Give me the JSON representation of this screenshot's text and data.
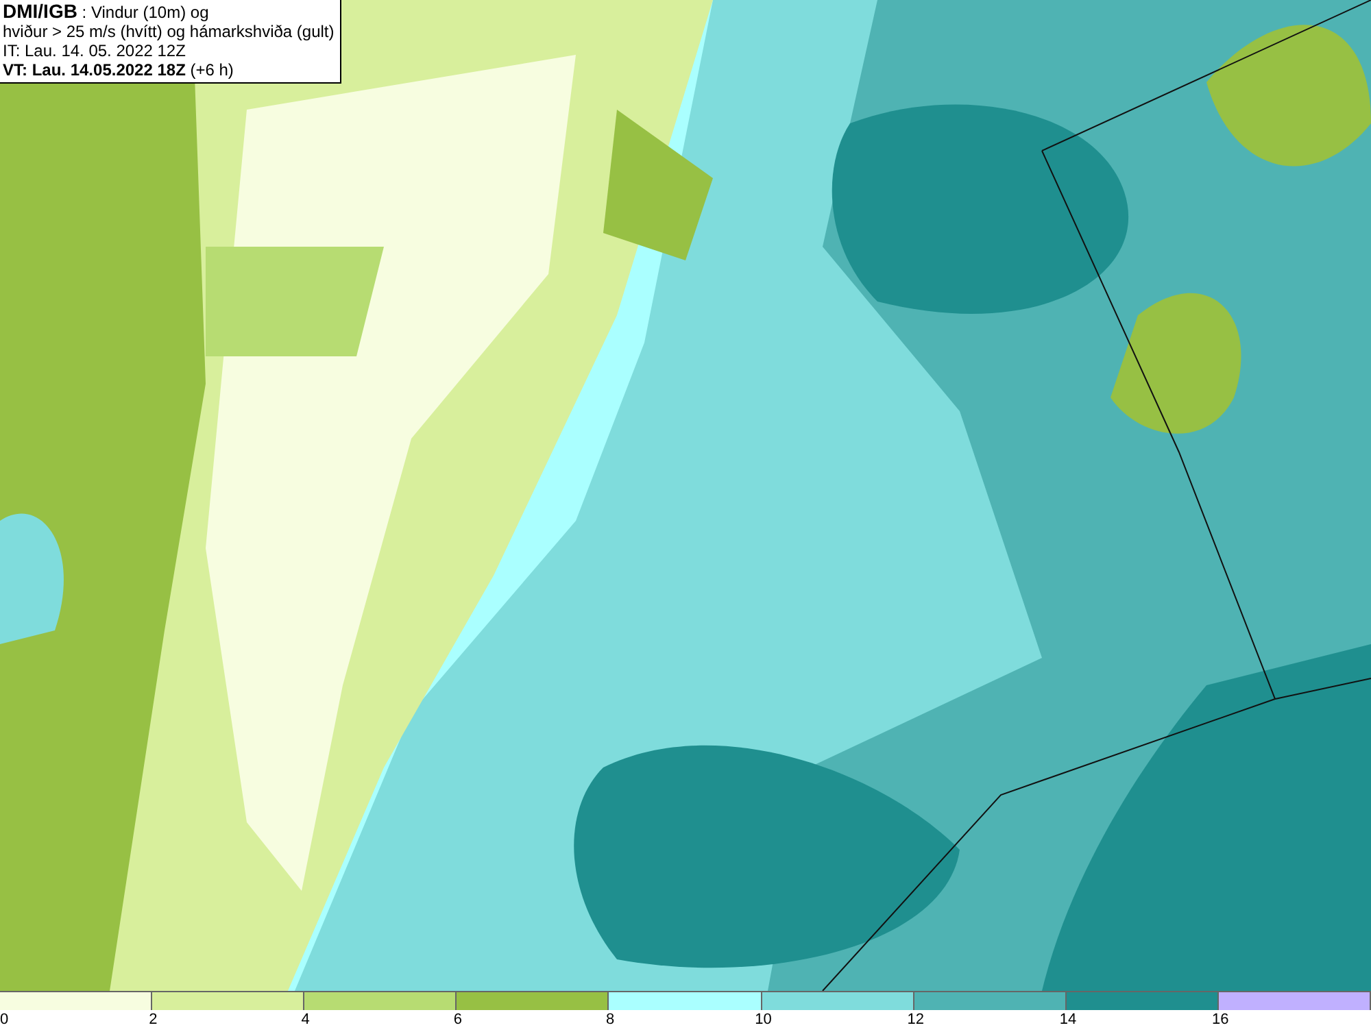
{
  "info_box": {
    "lines": [
      "**DMI/IGB** : Vindur (10m) og",
      "hviður > 25 m/s (hvítt) og hámarkshviða (gult)",
      "IT: Lau. 14. 05. 2022 12Z",
      "**VT: Lau. 14.05.2022 18Z** (+6 h)"
    ]
  },
  "legend": {
    "bins": [
      {
        "color": "#f7fde0"
      },
      {
        "color": "#d8ef9c"
      },
      {
        "color": "#b7dc72"
      },
      {
        "color": "#97c044"
      },
      {
        "color": "#aaffff"
      },
      {
        "color": "#7fdcdc"
      },
      {
        "color": "#4fb3b3"
      },
      {
        "color": "#1f8f8f"
      },
      {
        "color": "#c0b0ff"
      }
    ],
    "ticks": [
      "0",
      "2",
      "4",
      "6",
      "8",
      "10",
      "12",
      "14",
      "16"
    ]
  }
}
